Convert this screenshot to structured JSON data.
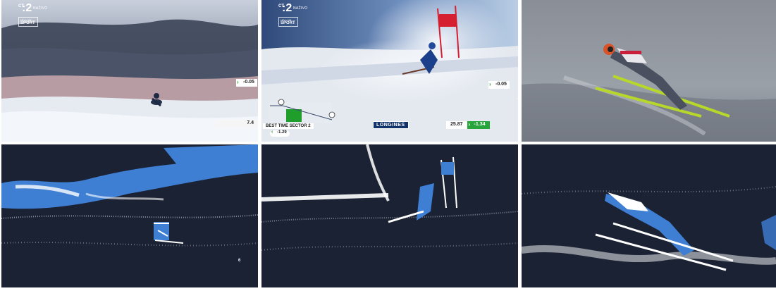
{
  "broadcast": {
    "channel_number": "2",
    "channel_prefix": "CT",
    "live_label": "NAŽIVO",
    "hd_line": "HD V 4K",
    "sport_label": "SPORT"
  },
  "panel_top_1": {
    "gain": "-0.05",
    "speed": "7.4"
  },
  "panel_top_2": {
    "gain": "-0.05",
    "sector_label": "BEST TIME SECTOR 2",
    "sector_diff": "-1.29",
    "sponsor": "LONGINES",
    "run_time": "25.87",
    "run_diff": "-1.34"
  },
  "panel_bottom_1": {
    "residual_text": "6"
  },
  "colors": {
    "overlay_green": "#27a43a",
    "sponsor_blue": "#12336b",
    "edge_bg": "#1b2233",
    "edge_blue": "#3e7fd4",
    "edge_white": "#ffffff"
  }
}
